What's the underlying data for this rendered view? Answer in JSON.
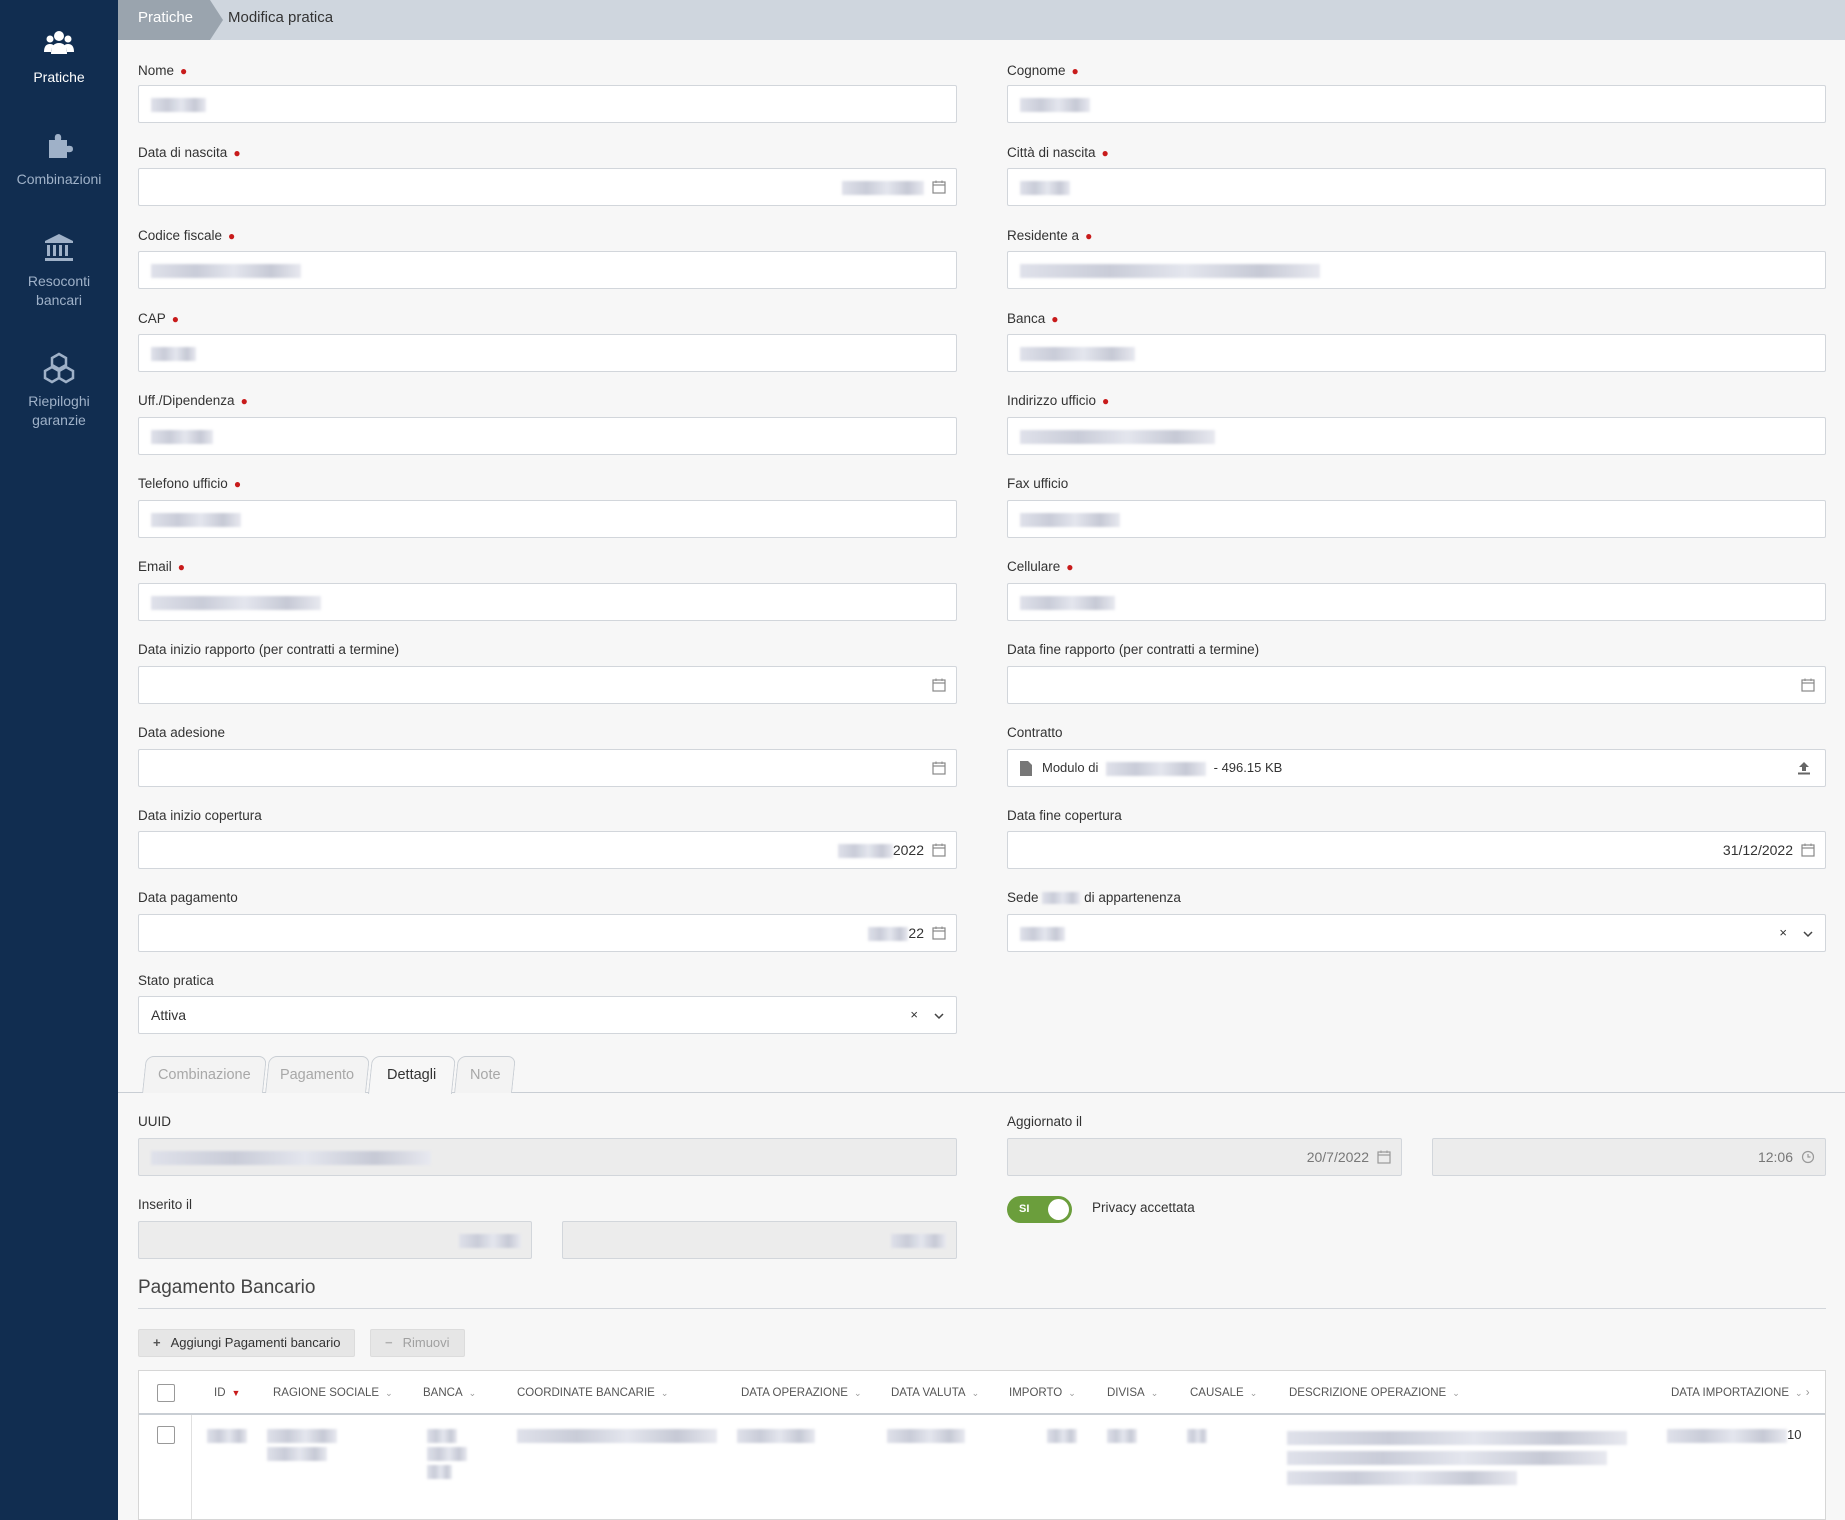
{
  "sidebar": {
    "items": [
      {
        "label": "Pratiche",
        "icon": "users-icon",
        "active": true
      },
      {
        "label": "Combinazioni",
        "icon": "puzzle-icon",
        "active": false
      },
      {
        "label": "Resoconti bancari",
        "icon": "bank-icon",
        "active": false
      },
      {
        "label": "Riepiloghi garanzie",
        "icon": "boxes-icon",
        "active": false
      }
    ]
  },
  "breadcrumb": {
    "root": "Pratiche",
    "current": "Modifica pratica"
  },
  "form": {
    "nome": {
      "label": "Nome"
    },
    "cognome": {
      "label": "Cognome"
    },
    "data_nascita": {
      "label": "Data di nascita"
    },
    "citta_nascita": {
      "label": "Città di nascita"
    },
    "codice_fiscale": {
      "label": "Codice fiscale"
    },
    "residente": {
      "label": "Residente a"
    },
    "cap": {
      "label": "CAP"
    },
    "banca": {
      "label": "Banca"
    },
    "uff": {
      "label": "Uff./Dipendenza"
    },
    "indirizzo_ufficio": {
      "label": "Indirizzo ufficio"
    },
    "telefono_ufficio": {
      "label": "Telefono ufficio"
    },
    "fax_ufficio": {
      "label": "Fax ufficio"
    },
    "email": {
      "label": "Email"
    },
    "cellulare": {
      "label": "Cellulare"
    },
    "data_inizio_rapporto": {
      "label": "Data inizio rapporto (per contratti a termine)"
    },
    "data_fine_rapporto": {
      "label": "Data fine rapporto (per contratti a termine)"
    },
    "data_adesione": {
      "label": "Data adesione"
    },
    "contratto": {
      "label": "Contratto",
      "file_prefix": "Modulo di",
      "file_size": "- 496.15 KB"
    },
    "data_inizio_copertura": {
      "label": "Data inizio copertura",
      "value_suffix": "2022"
    },
    "data_fine_copertura": {
      "label": "Data fine copertura",
      "value": "31/12/2022"
    },
    "data_pagamento": {
      "label": "Data pagamento",
      "value_suffix": "22"
    },
    "sede": {
      "label_start": "Sede",
      "label_end": "di appartenenza",
      "clear": "×"
    },
    "stato": {
      "label": "Stato pratica",
      "value": "Attiva",
      "clear": "×"
    }
  },
  "tabs": [
    {
      "label": "Combinazione",
      "active": false
    },
    {
      "label": "Pagamento",
      "active": false
    },
    {
      "label": "Dettagli",
      "active": true
    },
    {
      "label": "Note",
      "active": false
    }
  ],
  "details": {
    "uuid_label": "UUID",
    "aggiornato_label": "Aggiornato il",
    "aggiornato_date": "20/7/2022",
    "aggiornato_time": "12:06",
    "inserito_label": "Inserito il",
    "privacy_toggle": "SI",
    "privacy_label": "Privacy accettata"
  },
  "bank_payments": {
    "title": "Pagamento Bancario",
    "add_button": "Aggiungi Pagamenti bancario",
    "remove_button": "Rimuovi",
    "columns": [
      "ID",
      "RAGIONE SOCIALE",
      "BANCA",
      "COORDINATE BANCARIE",
      "DATA OPERAZIONE",
      "DATA VALUTA",
      "IMPORTO",
      "DIVISA",
      "CAUSALE",
      "DESCRIZIONE OPERAZIONE",
      "DATA IMPORTAZIONE"
    ],
    "row_import_suffix": "10"
  },
  "colors": {
    "sidebar": "#112d50",
    "accent_required": "#c81b1b",
    "toggle_on": "#6b9e3c"
  }
}
